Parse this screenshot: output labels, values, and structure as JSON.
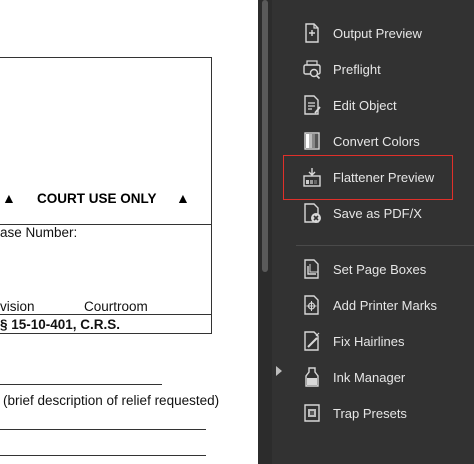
{
  "document": {
    "court_use": "COURT USE ONLY",
    "triangle_glyph": "▲",
    "case_number": "ase Number:",
    "division": "vision",
    "courtroom": "Courtroom",
    "statute": "§ 15-10-401, C.R.S.",
    "relief": "(brief description of relief requested)"
  },
  "tools": [
    {
      "label": "Output Preview",
      "icon": "output-preview-icon"
    },
    {
      "label": "Preflight",
      "icon": "preflight-icon"
    },
    {
      "label": "Edit Object",
      "icon": "edit-object-icon"
    },
    {
      "label": "Convert Colors",
      "icon": "convert-colors-icon"
    },
    {
      "label": "Flattener Preview",
      "icon": "flattener-preview-icon",
      "highlighted": true
    },
    {
      "label": "Save as PDF/X",
      "icon": "save-pdfx-icon"
    },
    {
      "label": "Set Page Boxes",
      "icon": "set-page-boxes-icon"
    },
    {
      "label": "Add Printer Marks",
      "icon": "add-printer-marks-icon"
    },
    {
      "label": "Fix Hairlines",
      "icon": "fix-hairlines-icon"
    },
    {
      "label": "Ink Manager",
      "icon": "ink-manager-icon"
    },
    {
      "label": "Trap Presets",
      "icon": "trap-presets-icon"
    }
  ],
  "colors": {
    "panel_bg": "#323232",
    "highlight": "#e0302a",
    "panel_text": "#e6e6e6"
  }
}
